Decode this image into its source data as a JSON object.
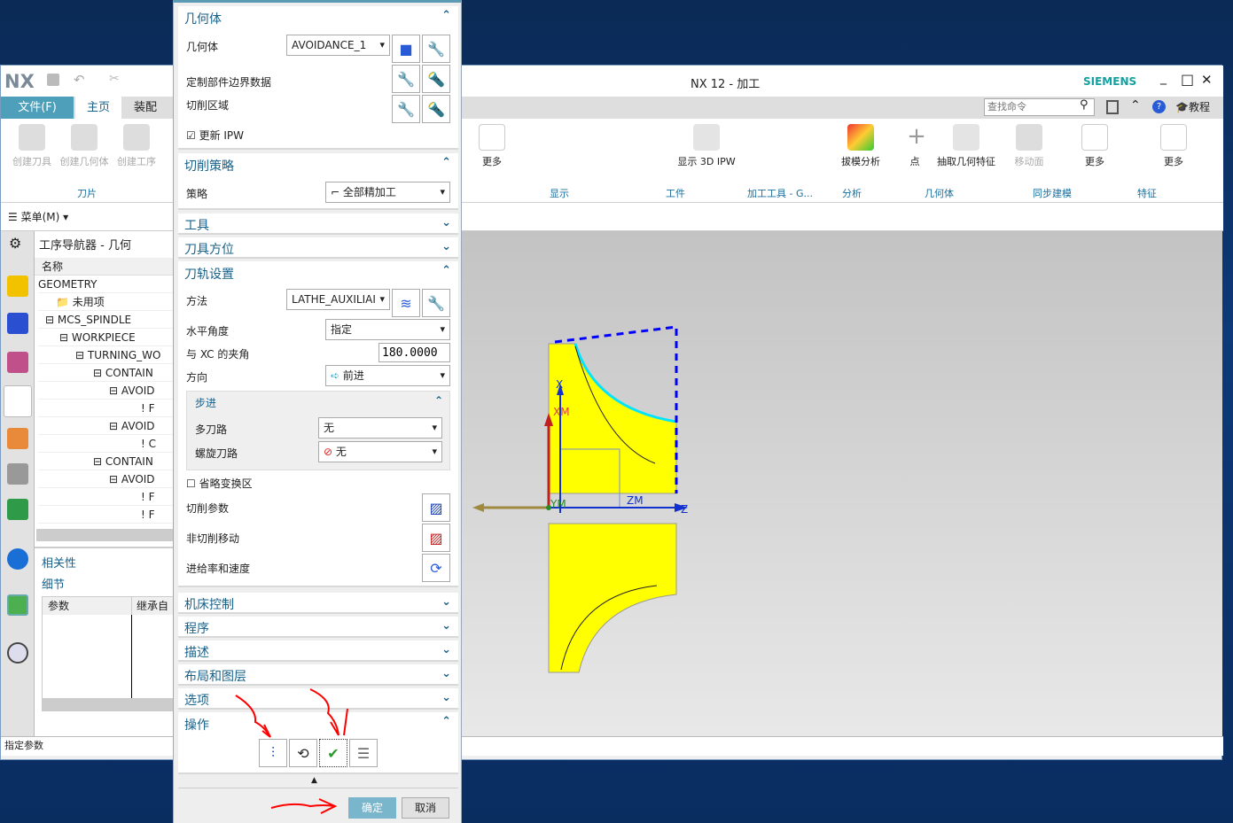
{
  "window": {
    "logo": "NX",
    "title": "NX 12 - 加工",
    "brand": "SIEMENS",
    "minimize": "_",
    "maximize": "□",
    "close": "✕"
  },
  "tabs": [
    {
      "label": "文件(F)"
    },
    {
      "label": "主页"
    },
    {
      "label": "装配"
    }
  ],
  "search": {
    "placeholder": "查找命令"
  },
  "tutorial": "教程",
  "ribbon": {
    "left_buttons": [
      {
        "label": "创建刀具"
      },
      {
        "label": "创建几何体"
      },
      {
        "label": "创建工序"
      }
    ],
    "left_group": "刀片",
    "buttons": [
      {
        "label": "更多"
      },
      {
        "label": "显示 3D IPW"
      },
      {
        "label": "拔模分析"
      },
      {
        "label": "点"
      },
      {
        "label": "抽取几何特征"
      },
      {
        "label": "移动面"
      },
      {
        "label": "更多"
      },
      {
        "label": "更多"
      }
    ],
    "groups": [
      {
        "label": "显示"
      },
      {
        "label": "工件"
      },
      {
        "label": "加工工具 - G..."
      },
      {
        "label": "分析"
      },
      {
        "label": "几何体"
      },
      {
        "label": "同步建模"
      },
      {
        "label": "特征"
      }
    ]
  },
  "menu_button": "菜单(M)",
  "navigator": {
    "title": "工序导航器 - 几何",
    "column": "名称",
    "rows": [
      "GEOMETRY",
      "未用项",
      "MCS_SPINDLE",
      "WORKPIECE",
      "TURNING_WO",
      "CONTAIN",
      "AVOID",
      "F",
      "AVOID",
      "C",
      "CONTAIN",
      "AVOID",
      "F",
      "F"
    ],
    "dependencies": "相关性",
    "details": "细节",
    "details_columns": [
      "参数",
      "继承自"
    ]
  },
  "status": "指定参数",
  "dialog": {
    "geometry": {
      "header": "几何体",
      "geometry_label": "几何体",
      "geometry_value": "AVOIDANCE_1",
      "custom_boundary": "定制部件边界数据",
      "cut_region": "切削区域",
      "update_ipw": "更新 IPW",
      "update_ipw_checked": true
    },
    "strategy": {
      "header": "切削策略",
      "label": "策略",
      "value": "全部精加工"
    },
    "tool": {
      "header": "工具"
    },
    "tool_orientation": {
      "header": "刀具方位"
    },
    "path": {
      "header": "刀轨设置",
      "method_label": "方法",
      "method_value": "LATHE_AUXILIAI",
      "level_angle_label": "水平角度",
      "level_angle_value": "指定",
      "xc_angle_label": "与 XC 的夹角",
      "xc_angle_value": "180.0000",
      "direction_label": "方向",
      "direction_value": "前进",
      "stepover": {
        "header": "步进",
        "multiple_label": "多刀路",
        "multiple_value": "无",
        "spiral_label": "螺旋刀路",
        "spiral_value": "无"
      },
      "omit_label": "省略变换区",
      "omit_checked": false,
      "cut_params": "切削参数",
      "non_cut": "非切削移动",
      "feeds": "进给率和速度"
    },
    "collapsed": [
      "机床控制",
      "程序",
      "描述",
      "布局和图层",
      "选项"
    ],
    "actions": {
      "header": "操作"
    },
    "ok": "确定",
    "cancel": "取消"
  },
  "viewport": {
    "labels": {
      "x": "X",
      "xm": "XM",
      "ym": "YM",
      "zm": "ZM",
      "z": "Z"
    }
  },
  "colors": {
    "accent": "#17618a",
    "file_tab": "#4e9fb9",
    "ok": "#7ab6cb",
    "part": "#ffff00",
    "boundary": "#0000ff",
    "edge": "#00e5ff",
    "annotation": "#ff0000"
  }
}
